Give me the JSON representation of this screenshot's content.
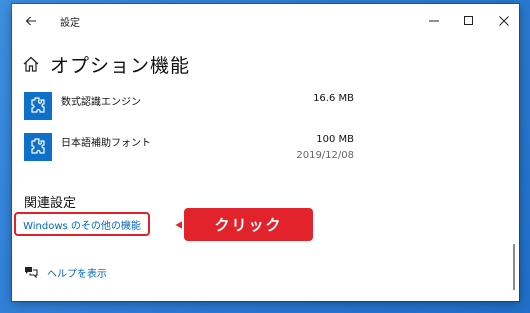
{
  "window": {
    "title": "設定"
  },
  "page": {
    "title": "オプション機能"
  },
  "features": [
    {
      "name": "数式認識エンジン",
      "size": "16.6 MB",
      "date": ""
    },
    {
      "name": "日本語補助フォント",
      "size": "100 MB",
      "date": "2019/12/08"
    }
  ],
  "related": {
    "heading": "関連設定",
    "link": "Windows のその他の機能"
  },
  "help": {
    "label": "ヘルプを表示"
  },
  "annotation": {
    "label": "クリック",
    "color": "#e3232c"
  },
  "colors": {
    "accent": "#0067c0",
    "tile": "#0f70c9"
  }
}
